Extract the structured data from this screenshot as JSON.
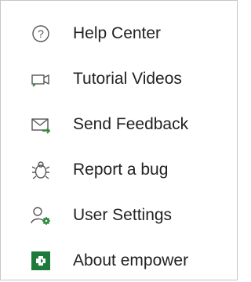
{
  "menu": {
    "items": [
      {
        "label": "Help Center",
        "icon": "help-circle-icon"
      },
      {
        "label": "Tutorial Videos",
        "icon": "video-camera-icon"
      },
      {
        "label": "Send Feedback",
        "icon": "envelope-send-icon"
      },
      {
        "label": "Report a bug",
        "icon": "bug-icon"
      },
      {
        "label": "User Settings",
        "icon": "user-settings-icon"
      },
      {
        "label": "About empower",
        "icon": "empower-logo-icon"
      }
    ]
  },
  "colors": {
    "icon_gray": "#555555",
    "accent_green": "#2e8b3a",
    "logo_green": "#1d7a3a",
    "border": "#c6c6c6",
    "text": "#222222"
  }
}
